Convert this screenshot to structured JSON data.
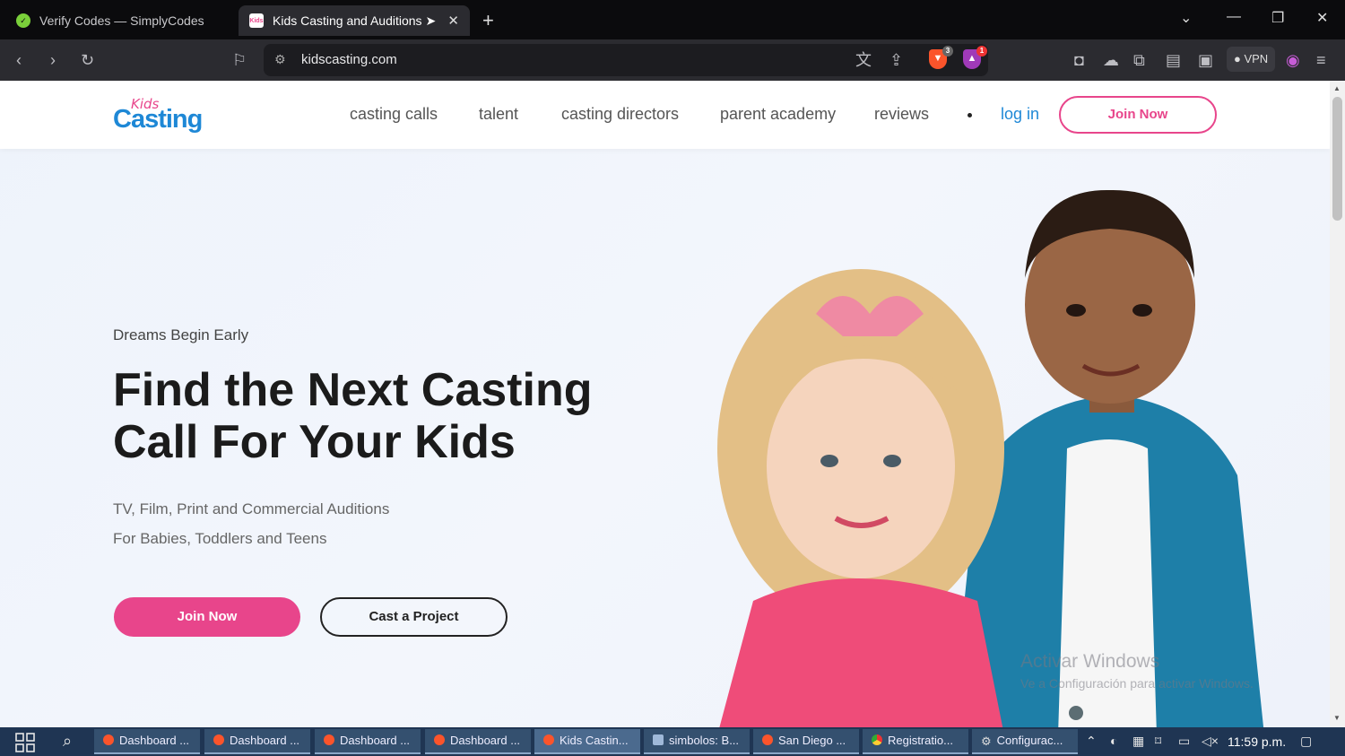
{
  "browser": {
    "tabs": [
      {
        "title": "Verify Codes — SimplyCodes",
        "active": false
      },
      {
        "title": "Kids Casting and Auditions ➤ Kids",
        "active": true
      }
    ],
    "url": "kidscasting.com",
    "shield_count": "3",
    "alert_count": "1",
    "vpn_label": "VPN"
  },
  "site": {
    "logo_small": "Kids",
    "logo_main": "Casting",
    "nav": [
      "casting calls",
      "talent",
      "casting directors",
      "parent academy",
      "reviews"
    ],
    "login": "log in",
    "header_join": "Join Now",
    "colors": {
      "brand_pink": "#e8458b",
      "brand_blue": "#1e88d6"
    }
  },
  "hero": {
    "eyebrow": "Dreams Begin Early",
    "headline_line1": "Find the Next Casting",
    "headline_line2": "Call For Your Kids",
    "sub1": "TV, Film, Print and Commercial Auditions",
    "sub2": "For Babies, Toddlers and Teens",
    "join_button": "Join Now",
    "cast_button": "Cast a Project"
  },
  "watermark": {
    "line1": "Activar Windows",
    "line2": "Ve a Configuración para activar Windows."
  },
  "taskbar": {
    "items": [
      {
        "label": "Dashboard ...",
        "icon": "brave"
      },
      {
        "label": "Dashboard ...",
        "icon": "brave"
      },
      {
        "label": "Dashboard ...",
        "icon": "brave"
      },
      {
        "label": "Dashboard ...",
        "icon": "brave"
      },
      {
        "label": "Kids Castin...",
        "icon": "brave",
        "active": true
      },
      {
        "label": "simbolos: B...",
        "icon": "notepad"
      },
      {
        "label": "San Diego ...",
        "icon": "brave"
      },
      {
        "label": "Registratio...",
        "icon": "chrome"
      },
      {
        "label": "Configurac...",
        "icon": "gear"
      }
    ],
    "clock": "11:59 p.m."
  }
}
